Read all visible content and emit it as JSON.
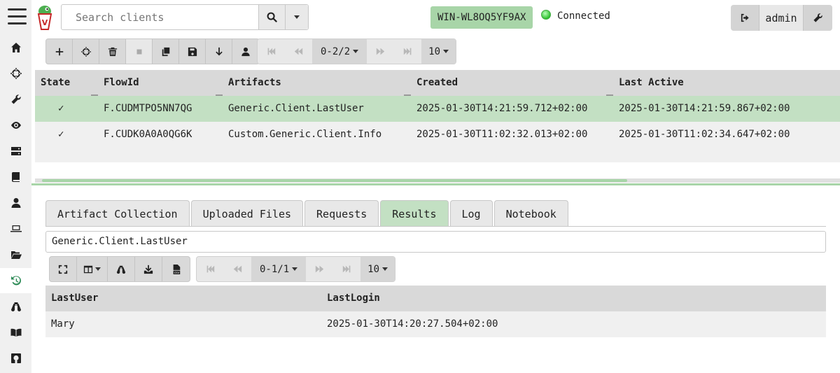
{
  "search": {
    "placeholder": "Search clients"
  },
  "client": {
    "hostname": "WIN-WL8OQ5YF9AX",
    "status": "Connected"
  },
  "user": {
    "name": "admin"
  },
  "sidebar": {
    "icons": [
      "home-icon",
      "crosshair-icon",
      "wrench-icon",
      "eye-icon",
      "server-icon",
      "book-icon",
      "user-icon",
      "laptop-icon",
      "folder-open-icon",
      "history-icon",
      "binoculars-icon",
      "book-open-icon",
      "github-icon"
    ],
    "active": "history-icon"
  },
  "flows": {
    "pager": {
      "range": "0-2/2",
      "page_size": "10"
    },
    "columns": [
      "State",
      "FlowId",
      "Artifacts",
      "Created",
      "Last Active"
    ],
    "rows": [
      {
        "state": "✓",
        "flow_id": "F.CUDMTPO5NN7QG",
        "artifacts": "Generic.Client.LastUser",
        "created": "2025-01-30T14:21:59.712+02:00",
        "last_active": "2025-01-30T14:21:59.867+02:00"
      },
      {
        "state": "✓",
        "flow_id": "F.CUDK0A0A0QG6K",
        "artifacts": "Custom.Generic.Client.Info",
        "created": "2025-01-30T11:02:32.013+02:00",
        "last_active": "2025-01-30T11:02:34.647+02:00"
      }
    ]
  },
  "tabs": [
    {
      "label": "Artifact Collection"
    },
    {
      "label": "Uploaded Files"
    },
    {
      "label": "Requests"
    },
    {
      "label": "Results"
    },
    {
      "label": "Log"
    },
    {
      "label": "Notebook"
    }
  ],
  "active_tab": "Results",
  "results": {
    "artifact": "Generic.Client.LastUser",
    "pager": {
      "range": "0-1/1",
      "page_size": "10"
    },
    "columns": [
      "LastUser",
      "LastLogin"
    ],
    "rows": [
      {
        "last_user": "Mary",
        "last_login": "2025-01-30T14:20:27.504+02:00"
      }
    ]
  },
  "colors": {
    "accent": "#a8d5a8",
    "selected_row": "#c3e0c3",
    "status_green": "#2fc02f"
  }
}
